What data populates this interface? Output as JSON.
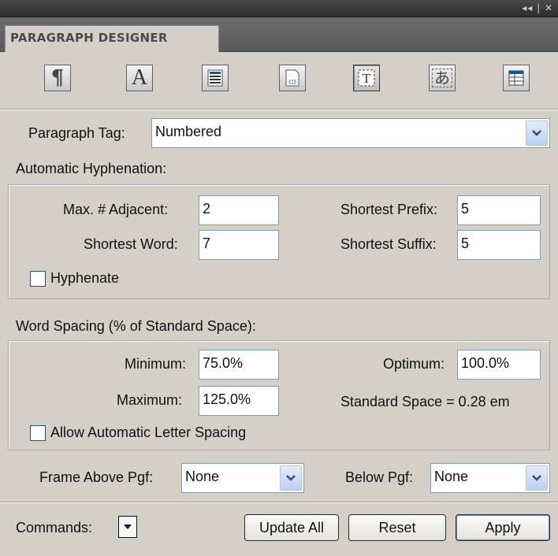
{
  "window": {
    "controls": "◂◂ | ✕"
  },
  "tab": {
    "label": "PARAGRAPH DESIGNER"
  },
  "toolbar": {
    "icons": [
      {
        "name": "paragraph-icon",
        "glyph": "¶"
      },
      {
        "name": "character-icon",
        "glyph": "A"
      },
      {
        "name": "pagination-icon",
        "glyph": ""
      },
      {
        "name": "numbering-icon",
        "glyph": ""
      },
      {
        "name": "advanced-icon",
        "glyph": ""
      },
      {
        "name": "asian-icon",
        "glyph": "あ"
      },
      {
        "name": "table-cell-icon",
        "glyph": ""
      }
    ]
  },
  "paragraph_tag": {
    "label": "Paragraph Tag:",
    "value": "Numbered"
  },
  "hyphenation": {
    "heading": "Automatic Hyphenation:",
    "max_adjacent_label": "Max. # Adjacent:",
    "max_adjacent_value": "2",
    "shortest_word_label": "Shortest Word:",
    "shortest_word_value": "7",
    "shortest_prefix_label": "Shortest Prefix:",
    "shortest_prefix_value": "5",
    "shortest_suffix_label": "Shortest Suffix:",
    "shortest_suffix_value": "5",
    "hyphenate_label": "Hyphenate",
    "hyphenate_checked": false
  },
  "word_spacing": {
    "heading": "Word Spacing (% of Standard Space):",
    "minimum_label": "Minimum:",
    "minimum_value": "75.0%",
    "maximum_label": "Maximum:",
    "maximum_value": "125.0%",
    "optimum_label": "Optimum:",
    "optimum_value": "100.0%",
    "standard_space": "Standard Space = 0.28 em",
    "letter_spacing_label": "Allow Automatic Letter Spacing",
    "letter_spacing_checked": false
  },
  "frames": {
    "above_label": "Frame Above Pgf:",
    "above_value": "None",
    "below_label": "Below Pgf:",
    "below_value": "None"
  },
  "footer": {
    "commands_label": "Commands:",
    "update_all": "Update All",
    "reset": "Reset",
    "apply": "Apply"
  }
}
